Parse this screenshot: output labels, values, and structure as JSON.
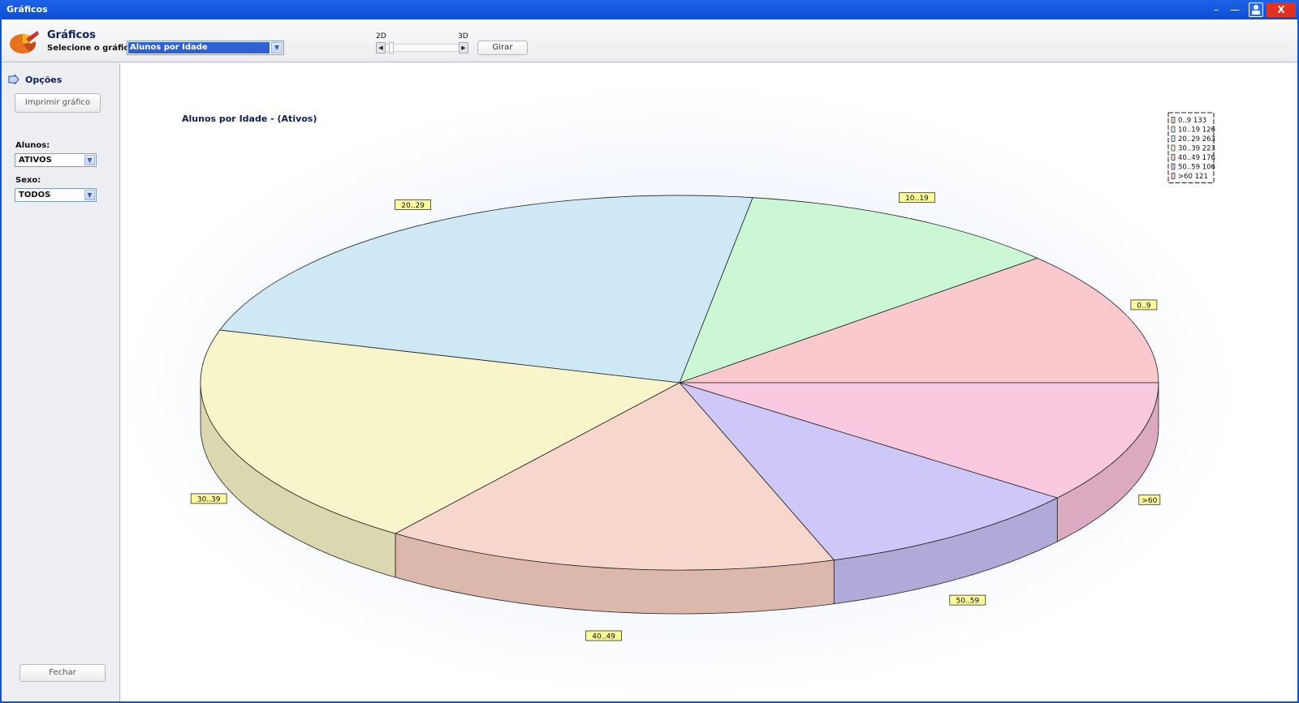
{
  "window": {
    "title": "Gráficos",
    "close_label": "X"
  },
  "header": {
    "title": "Gráficos",
    "subtitle": "Selecione o gráfico",
    "selected_chart": "Alunos por Idade",
    "label_2d": "2D",
    "label_3d": "3D",
    "rotate_label": "Girar"
  },
  "sidebar": {
    "title": "Opções",
    "print_label": "Imprimir gráfico",
    "students_label": "Alunos:",
    "students_value": "ATIVOS",
    "sex_label": "Sexo:",
    "sex_value": "TODOS",
    "close_label": "Fechar"
  },
  "chart_data": {
    "type": "pie",
    "title": "Alunos por Idade - (Ativos)",
    "categories": [
      "0..9",
      "10..19",
      "20..29",
      "30..39",
      "40..49",
      "50..59",
      ">60"
    ],
    "values": [
      133,
      126,
      263,
      223,
      176,
      106,
      121
    ],
    "legend_entries": [
      "0..9 133",
      "10..19 126",
      "20..29 263",
      "30..39 223",
      "40..49 176",
      "50..59 106",
      ">60 121"
    ],
    "colors": [
      "#f9c9ce",
      "#cbf7d4",
      "#cfe8f6",
      "#f7f5c9",
      "#f7d6cb",
      "#cdc8f7",
      "#f8c9df"
    ],
    "side_colors": [
      "#dab0b5",
      "#aed8b8",
      "#b0c9d8",
      "#dbd8b0",
      "#dbb8ab",
      "#b0aad8",
      "#dbaac0"
    ],
    "legend_position": "top-right",
    "style": "3d"
  }
}
